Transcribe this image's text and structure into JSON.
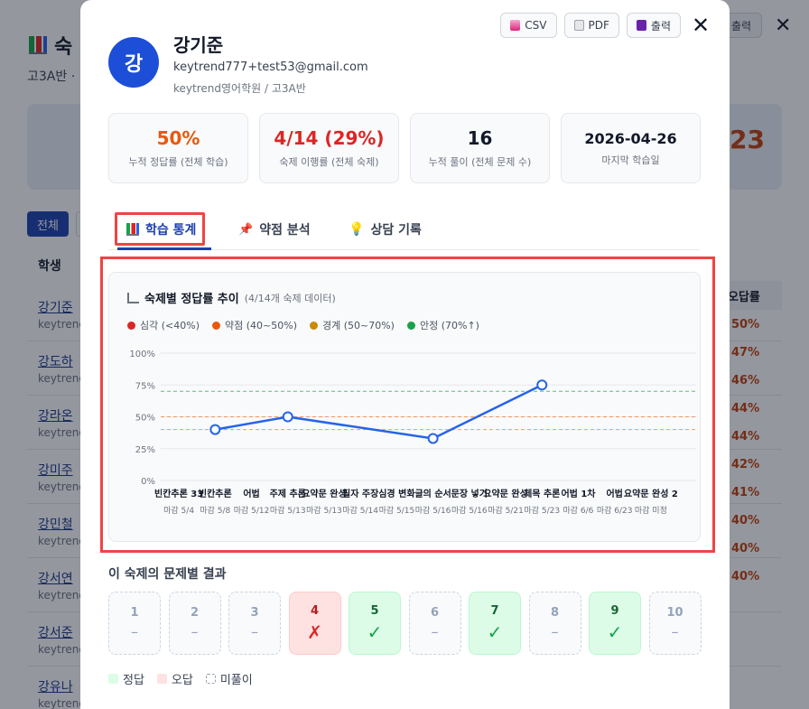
{
  "background": {
    "title": "숙",
    "subtitle": "고3A반 ·",
    "big_number": "23",
    "tab_all": "전체",
    "col_student": "학생",
    "col_wrong_rate": "오답률",
    "print_label": "출력",
    "rows": [
      {
        "name": "강기준",
        "email": "keytrend",
        "pct": "50%"
      },
      {
        "name": "강도하",
        "email": "keytrend",
        "pct": "47%"
      },
      {
        "name": "강라온",
        "email": "keytrend",
        "pct": "46%"
      },
      {
        "name": "강미주",
        "email": "keytrend",
        "pct": "44%"
      },
      {
        "name": "강민철",
        "email": "keytrend",
        "pct": "44%"
      },
      {
        "name": "강서연",
        "email": "keytrend",
        "pct": "42%"
      },
      {
        "name": "강서준",
        "email": "keytrend",
        "pct": "41%"
      },
      {
        "name": "강유나",
        "email": "keytrend",
        "pct": "40%"
      }
    ],
    "extra_pcts": [
      "40%",
      "40%"
    ]
  },
  "modal": {
    "actions": {
      "csv": "CSV",
      "pdf": "PDF",
      "print": "출력"
    },
    "student": {
      "avatar": "강",
      "name": "강기준",
      "email": "keytrend777+test53@gmail.com",
      "org": "keytrend영어학원 / 고3A반"
    },
    "stats": [
      {
        "value": "50%",
        "label": "누적 정답률 (전체 학습)",
        "color": "#ea580c"
      },
      {
        "value": "4/14 (29%)",
        "label": "숙제 이행률 (전체 숙제)",
        "color": "#dc2626"
      },
      {
        "value": "16",
        "label": "누적 풀이 (전체 문제 수)",
        "color": "#111827"
      },
      {
        "value": "2026-04-26",
        "label": "마지막 학습일",
        "color": "#111827"
      }
    ],
    "tabs": [
      {
        "label": "학습 통계",
        "icon": "bar-chart-icon",
        "active": true
      },
      {
        "label": "약점 분석",
        "icon": "pushpin-icon",
        "active": false
      },
      {
        "label": "상담 기록",
        "icon": "lightbulb-icon",
        "active": false
      }
    ],
    "chart_title": "숙제별 정답률 추이",
    "chart_subtitle": "(4/14개 숙제 데이터)",
    "legend": [
      {
        "label": "심각 (<40%)",
        "color": "#dc2626"
      },
      {
        "label": "약점 (40~50%)",
        "color": "#ea580c"
      },
      {
        "label": "경계 (50~70%)",
        "color": "#ca8a04"
      },
      {
        "label": "안정 (70%↑)",
        "color": "#16a34a"
      }
    ],
    "results_title": "이 숙제의 문제별 결과",
    "problems": [
      {
        "n": "1",
        "mark": "–",
        "state": "none"
      },
      {
        "n": "2",
        "mark": "–",
        "state": "none"
      },
      {
        "n": "3",
        "mark": "–",
        "state": "none"
      },
      {
        "n": "4",
        "mark": "✗",
        "state": "bad"
      },
      {
        "n": "5",
        "mark": "✓",
        "state": "ok"
      },
      {
        "n": "6",
        "mark": "–",
        "state": "none"
      },
      {
        "n": "7",
        "mark": "✓",
        "state": "ok"
      },
      {
        "n": "8",
        "mark": "–",
        "state": "none"
      },
      {
        "n": "9",
        "mark": "✓",
        "state": "ok"
      },
      {
        "n": "10",
        "mark": "–",
        "state": "none"
      }
    ],
    "key": {
      "ok": "정답",
      "bad": "오답",
      "none": "미풀이"
    }
  },
  "chart_data": {
    "type": "line",
    "title": "숙제별 정답률 추이",
    "subtitle": "(4/14개 숙제 데이터)",
    "ylim": [
      0,
      100
    ],
    "yticks": [
      "0%",
      "25%",
      "50%",
      "75%",
      "100%"
    ],
    "categories": [
      "빈칸추론 33",
      "빈칸추론",
      "어법",
      "주제 추론",
      "요약문 완성",
      "필자 주장",
      "심경 변화",
      "글의 순서",
      "문장 넣기",
      "요약문 완성",
      "제목 추론",
      "어법 1차",
      "어법",
      "요약문 완성 2"
    ],
    "dates": [
      "마감 5/4",
      "마감 5/8",
      "마감 5/12",
      "마감 5/13",
      "마감 5/13",
      "마감 5/14",
      "마감 5/15",
      "마감 5/16",
      "마감 5/16",
      "마감 5/21",
      "마감 5/23",
      "마감 6/6",
      "마감 6/23",
      "마감 미정"
    ],
    "series": [
      {
        "values": [
          null,
          40,
          null,
          50,
          null,
          null,
          null,
          33,
          null,
          null,
          75,
          null,
          null,
          null
        ],
        "color": "#2563eb"
      }
    ],
    "reference_lines": [
      {
        "value": 70,
        "color": "#16a34a"
      },
      {
        "value": 50,
        "color": "#f97316"
      },
      {
        "value": 40,
        "color": "#f97316"
      }
    ],
    "grid": true
  }
}
